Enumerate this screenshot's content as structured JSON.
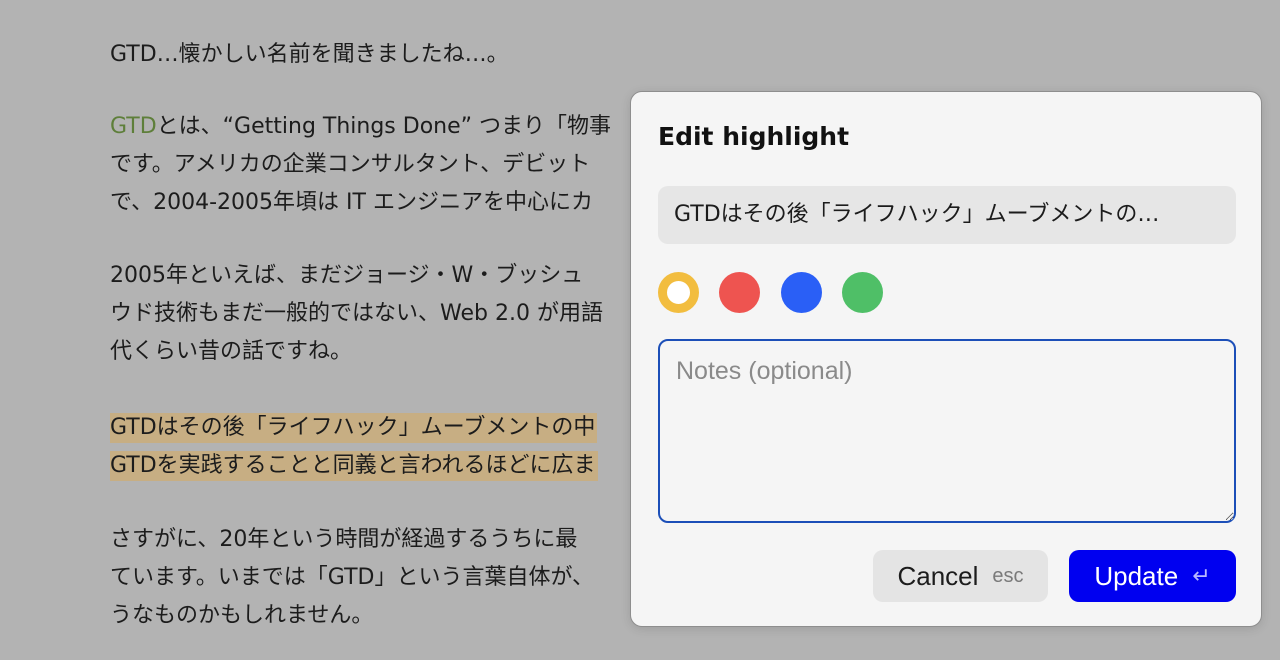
{
  "article": {
    "p1": {
      "line1": "GTD…懐かしい名前を聞きましたね…。"
    },
    "p2": {
      "link": "GTD",
      "line1_rest": "とは、“Getting Things Done” つまり「物事",
      "line2": "です。アメリカの企業コンサルタント、デビット",
      "line3": "で、2004-2005年頃は IT エンジニアを中心にカ"
    },
    "p3": {
      "line1": "2005年といえば、まだジョージ・W・ブッシュ",
      "line2": "ウド技術もまだ一般的ではない、Web 2.0 が用語",
      "line3": "代くらい昔の話ですね。"
    },
    "p4": {
      "line1": "GTDはその後「ライフハック」ムーブメントの中",
      "line2": "GTDを実践することと同義と言われるほどに広ま"
    },
    "p5": {
      "line1": "さすがに、20年という時間が経過するうちに最",
      "line2": "ています。いまでは「GTD」という言葉自体が、",
      "line3": "うなものかもしれません。"
    }
  },
  "dialog": {
    "title": "Edit highlight",
    "quote": "GTDはその後「ライフハック」ムーブメントの…",
    "colors": {
      "yellow": "#f2bd3f",
      "red": "#ee5450",
      "blue": "#2a5ff6",
      "green": "#4fbf67",
      "selected": "yellow"
    },
    "notes_placeholder": "Notes (optional)",
    "notes_value": "",
    "cancel_label": "Cancel",
    "cancel_hint": "esc",
    "update_label": "Update",
    "update_hint": "↵"
  }
}
